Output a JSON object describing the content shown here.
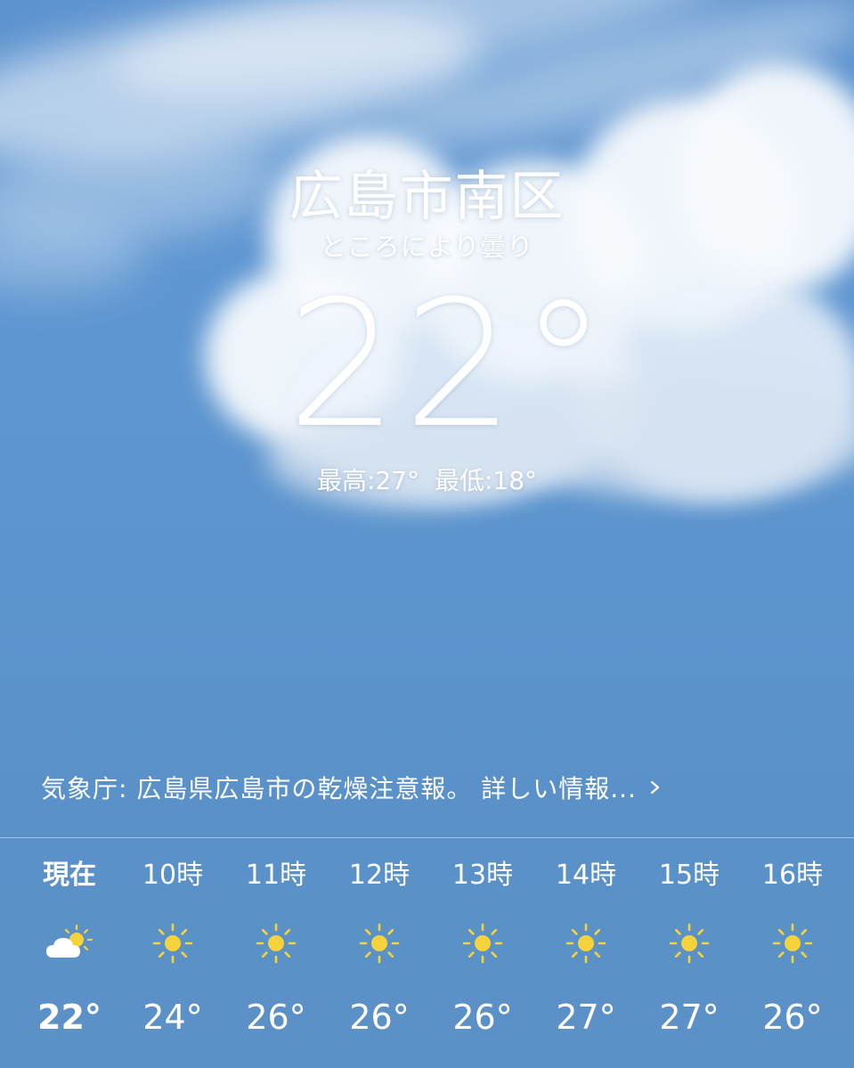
{
  "header": {
    "location": "広島市南区",
    "condition": "ところにより曇り",
    "temperature": "22°",
    "high": "最高:27°",
    "low": "最低:18°"
  },
  "alert": {
    "text": "気象庁: 広島県広島市の乾燥注意報。 詳しい情報...",
    "chevron_icon": "chevron-right-icon"
  },
  "hourly": [
    {
      "time": "現在",
      "icon": "partly-cloudy-icon",
      "temp": "22°"
    },
    {
      "time": "10時",
      "icon": "sun-icon",
      "temp": "24°"
    },
    {
      "time": "11時",
      "icon": "sun-icon",
      "temp": "26°"
    },
    {
      "time": "12時",
      "icon": "sun-icon",
      "temp": "26°"
    },
    {
      "time": "13時",
      "icon": "sun-icon",
      "temp": "26°"
    },
    {
      "time": "14時",
      "icon": "sun-icon",
      "temp": "27°"
    },
    {
      "time": "15時",
      "icon": "sun-icon",
      "temp": "27°"
    },
    {
      "time": "16時",
      "icon": "sun-icon",
      "temp": "26°"
    }
  ],
  "colors": {
    "sky": "#5c94cd",
    "sun": "#f6d23b",
    "text": "#ffffff"
  }
}
